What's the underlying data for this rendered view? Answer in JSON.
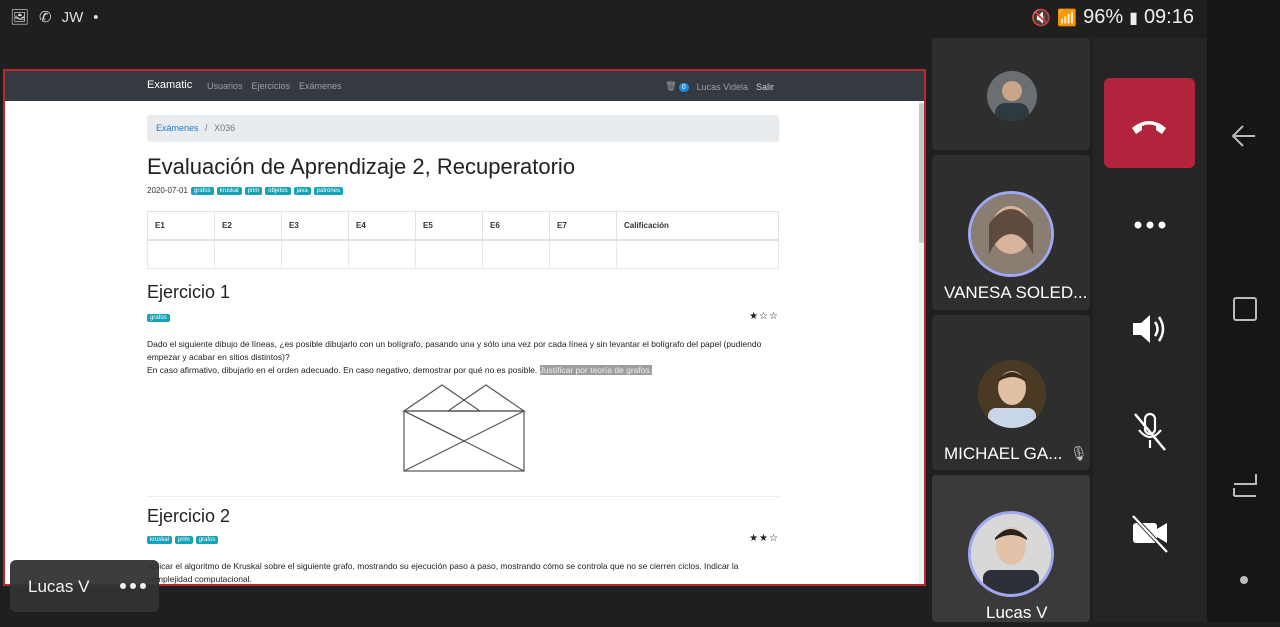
{
  "status": {
    "left_label": "JW",
    "battery": "96%",
    "time": "09:16"
  },
  "app": {
    "brand": "Examatic",
    "nav": [
      "Usuarios",
      "Ejercicios",
      "Exámenes"
    ],
    "badge": "0",
    "user": "Lucas Videla",
    "logout": "Salir"
  },
  "breadcrumb": {
    "root": "Exámenes",
    "sep": "/",
    "current": "X036"
  },
  "exam": {
    "title": "Evaluación de Aprendizaje 2, Recuperatorio",
    "date": "2020-07-01",
    "tags": [
      "grafos",
      "kruskal",
      "prim",
      "objetos",
      "java",
      "patrones"
    ]
  },
  "table": {
    "headers": [
      "E1",
      "E2",
      "E3",
      "E4",
      "E5",
      "E6",
      "E7",
      "Calificación"
    ]
  },
  "exercises": [
    {
      "title": "Ejercicio 1",
      "tags": [
        "grafos"
      ],
      "stars": "★☆☆",
      "text1": "Dado el siguiente dibujo de líneas, ¿es posible dibujarlo con un bolígrafo, pasando una y sólo una vez por cada línea y sin levantar el bolígrafo del papel (pudiendo empezar y acabar en sitios distintos)?",
      "text2": "En caso afirmativo, dibujarlo en el orden adecuado. En caso negativo, demostrar por qué no es posible.",
      "highlight": "Justificar por teoría de grafos."
    },
    {
      "title": "Ejercicio 2",
      "tags": [
        "kruskal",
        "prim",
        "grafos"
      ],
      "stars": "★★☆",
      "text1": "Aplicar el algoritmo de Kruskal sobre el siguiente grafo, mostrando su ejecución paso a paso, mostrando cómo se controla que no se cierren ciclos. Indicar la complejidad computacional."
    }
  ],
  "participants": [
    {
      "name": ""
    },
    {
      "name": "VANESA SOLED..."
    },
    {
      "name": "MICHAEL GA..."
    },
    {
      "name": "Lucas V"
    }
  ],
  "self_label": "Lucas V",
  "colors": {
    "hangup": "#b1243b",
    "navbar": "#343a40",
    "tag": "#17a2b8",
    "share_border": "#b8282d"
  }
}
